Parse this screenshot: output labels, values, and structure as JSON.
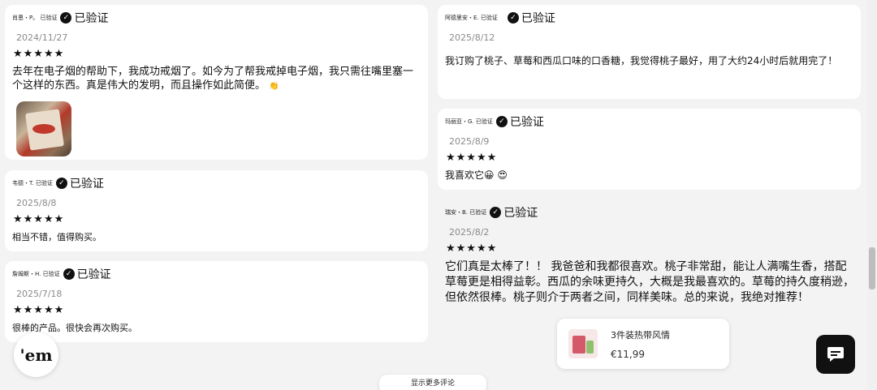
{
  "verified_label": "已验证",
  "reviews": [
    {
      "reviewer": "肖恩・P。 已验证",
      "date": "2024/11/27",
      "stars": "★★★★★",
      "text": "去年在电子烟的帮助下，我成功戒烟了。如今为了帮我戒掉电子烟，我只需往嘴里塞一个这样的东西。真是伟大的发明，而且操作如此简便。",
      "emoji": "👏"
    },
    {
      "reviewer": "韦德・T. 已验证",
      "date": "2025/8/8",
      "stars": "★★★★★",
      "text": "相当不错，值得购买。"
    },
    {
      "reviewer": "詹姆斯・H. 已验证",
      "date": "2025/7/18",
      "stars": "★★★★★",
      "text": "很棒的产品。很快会再次购买。"
    },
    {
      "reviewer": "阿德里安・E. 已验证",
      "date": "2025/8/12",
      "stars": "",
      "text": "我订购了桃子、草莓和西瓜口味的口香糖，我觉得桃子最好，用了大约24小时后就用完了！"
    },
    {
      "reviewer": "玛丽亚・G. 已验证",
      "date": "2025/8/9",
      "stars": "★★★★★",
      "text": "我喜欢它😀 😍"
    },
    {
      "reviewer": "瑞安・B. 已验证",
      "date": "2025/8/2",
      "stars": "★★★★★",
      "text": "它们真是太棒了！！ 我爸爸和我都很喜欢。桃子非常甜，能让人满嘴生香，搭配草莓更是相得益彰。西瓜的余味更持久，大概是我最喜欢的。草莓的持久度稍逊，但依然很棒。桃子则介于两者之间，同样美味。总的来说，我绝对推荐！"
    }
  ],
  "logo_text": "'em",
  "cart": {
    "title": "3件装热带风情",
    "price": "€11,99"
  },
  "show_more_label": "显示更多评论",
  "icons": {
    "verified": "check-circle-icon",
    "chat": "chat-bubble-icon"
  }
}
